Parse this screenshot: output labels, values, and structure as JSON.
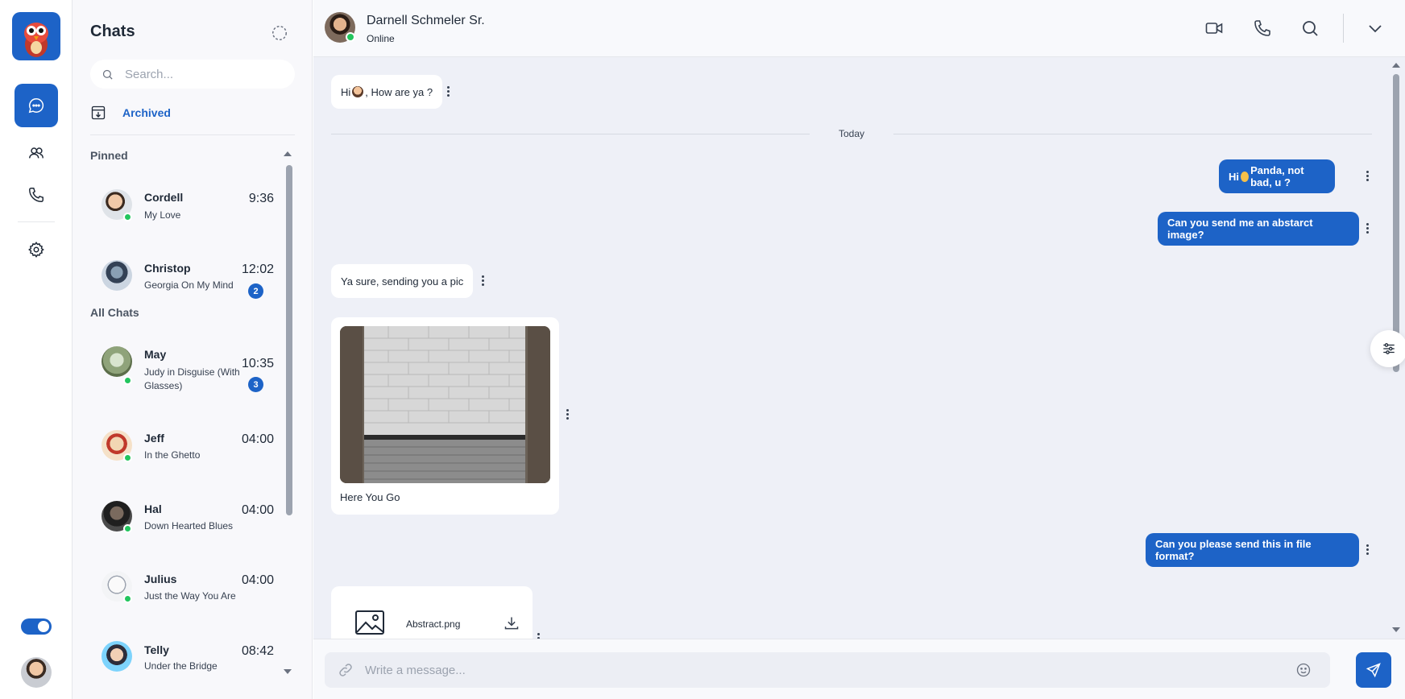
{
  "colors": {
    "accent": "#1d63c7",
    "online": "#22c55e",
    "panel_bg": "#f8f8fb",
    "conv_bg": "#eef0f7"
  },
  "rail": {
    "items": [
      {
        "icon": "chat-icon",
        "active": true
      },
      {
        "icon": "contacts-icon",
        "active": false
      },
      {
        "icon": "phone-icon",
        "active": false
      },
      {
        "icon": "gear-icon",
        "active": false
      }
    ],
    "theme_toggle_on": true
  },
  "panel": {
    "title": "Chats",
    "search_placeholder": "Search...",
    "archived_label": "Archived",
    "pinned_label": "Pinned",
    "all_label": "All Chats",
    "pinned": [
      {
        "name": "Cordell",
        "preview": "My Love",
        "time": "9:36",
        "online": true
      },
      {
        "name": "Christop",
        "preview": "Georgia On My Mind",
        "time": "12:02",
        "unread": "2",
        "online": false
      }
    ],
    "all": [
      {
        "name": "May",
        "preview": "Judy in Disguise (With Glasses)",
        "time": "10:35",
        "unread": "3",
        "online": true
      },
      {
        "name": "Jeff",
        "preview": "In the Ghetto",
        "time": "04:00",
        "online": true
      },
      {
        "name": "Hal",
        "preview": "Down Hearted Blues",
        "time": "04:00",
        "online": true
      },
      {
        "name": "Julius",
        "preview": "Just the Way You Are",
        "time": "04:00",
        "online": true
      },
      {
        "name": "Telly",
        "preview": "Under the Bridge",
        "time": "08:42",
        "online": false
      }
    ]
  },
  "conversation": {
    "contact_name": "Darnell Schmeler Sr.",
    "contact_status": "Online",
    "header_icons": [
      "video-icon",
      "phone-icon",
      "search-icon",
      "chevron-down-icon"
    ],
    "date_divider": "Today",
    "messages": {
      "m1": {
        "pre": "Hi",
        "post": ", How are ya ?"
      },
      "m2": {
        "pre": "Hi",
        "post": " Panda, not bad, u ?"
      },
      "m3": "Can you send me an abstarct image?",
      "m4": "Ya sure, sending you a pic",
      "m5_caption": "Here You Go",
      "m6": "Can you please send this in file format?",
      "file_name": "Abstract.png"
    },
    "composer_placeholder": "Write a message..."
  }
}
